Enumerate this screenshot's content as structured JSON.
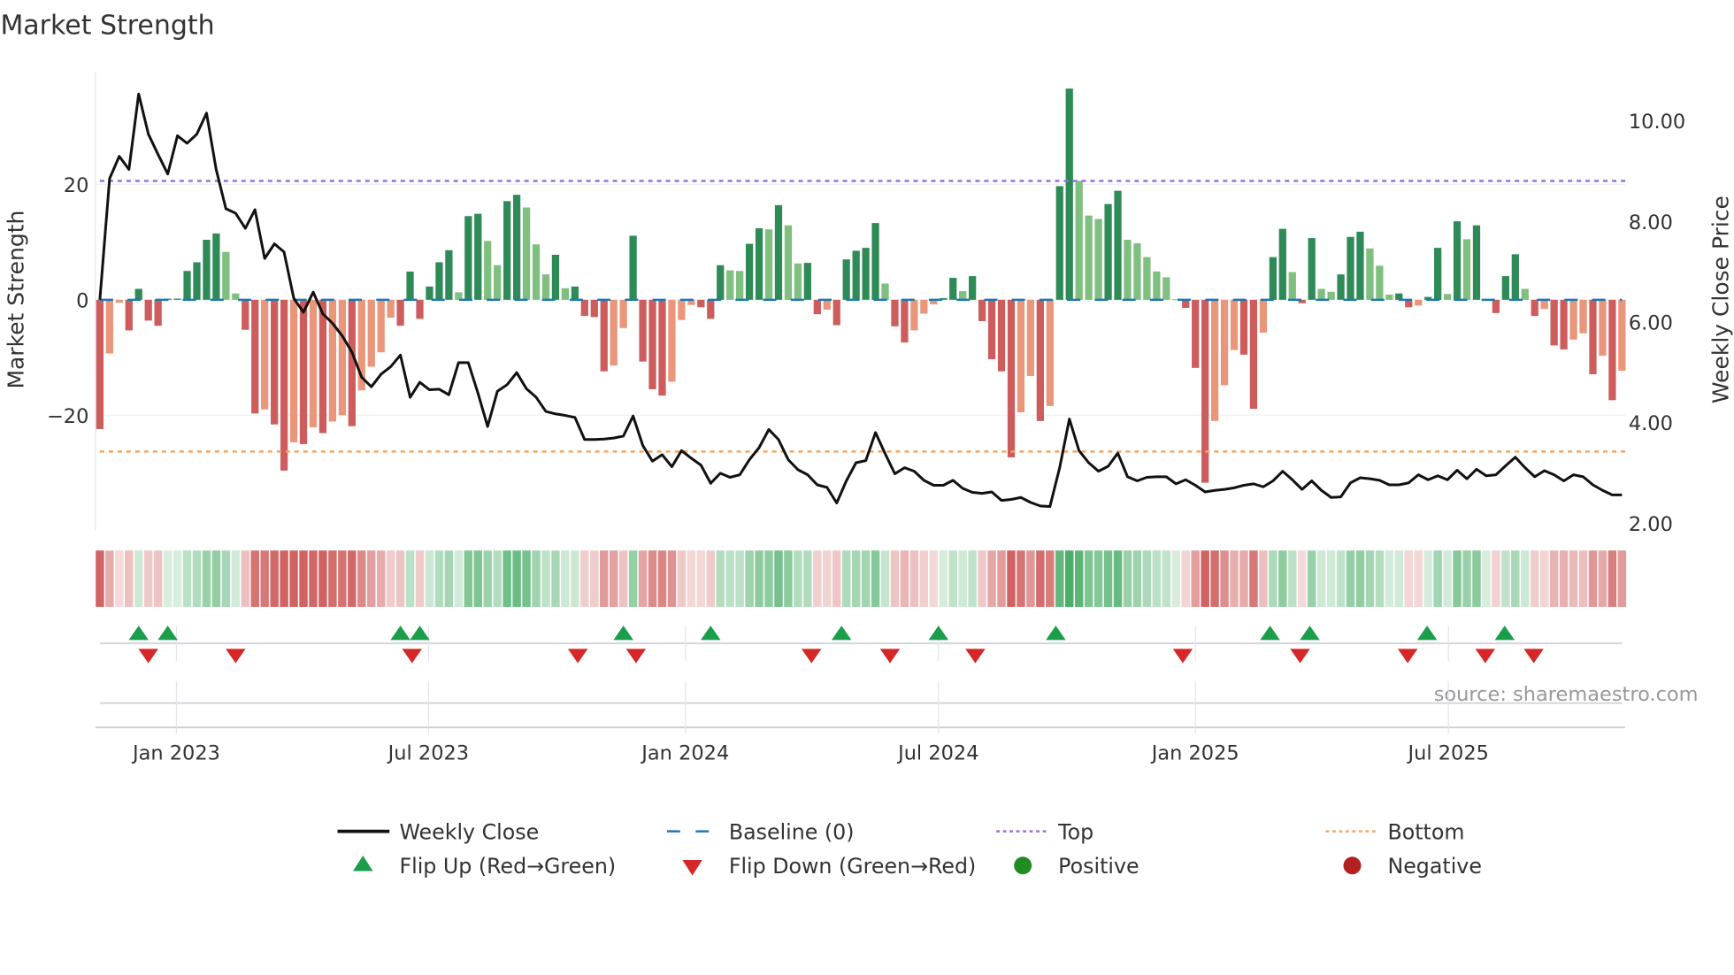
{
  "chart_data": {
    "type": "bar",
    "title": "Market Strength",
    "ylabel_left": "Market Strength",
    "ylabel_right": "Weekly Close Price",
    "source": "source: sharemaestro.com",
    "ylim_left": [
      -40,
      39.5
    ],
    "ylim_right": [
      1.85,
      10.97
    ],
    "yticks_left": [
      {
        "value": 20,
        "label": "20"
      },
      {
        "value": 0,
        "label": "0"
      },
      {
        "value": -20,
        "label": "−20"
      }
    ],
    "yticks_right": [
      {
        "value": 10,
        "label": "10.00"
      },
      {
        "value": 8,
        "label": "8.00"
      },
      {
        "value": 6,
        "label": "6.00"
      },
      {
        "value": 4,
        "label": "4.00"
      },
      {
        "value": 2,
        "label": "2.00"
      }
    ],
    "xticks": [
      {
        "index": 7.9,
        "label": "Jan 2023"
      },
      {
        "index": 33.9,
        "label": "Jul 2023"
      },
      {
        "index": 60.4,
        "label": "Jan 2024"
      },
      {
        "index": 86.5,
        "label": "Jul 2024"
      },
      {
        "index": 113,
        "label": "Jan 2025"
      },
      {
        "index": 139.1,
        "label": "Jul 2025"
      }
    ],
    "top_level": 20.6,
    "bottom_level": -26.3,
    "strength": [
      -22.4,
      -9.3,
      -0.5,
      -5.3,
      1.9,
      -3.6,
      -4.5,
      0.2,
      0.2,
      5.0,
      6.5,
      10.4,
      11.5,
      8.3,
      1.1,
      -5.2,
      -19.7,
      -19.0,
      -21.6,
      -29.6,
      -24.7,
      -25.0,
      -22.1,
      -23.1,
      -21.1,
      -20.0,
      -21.9,
      -15.7,
      -11.6,
      -9.1,
      -3.1,
      -4.5,
      4.9,
      -3.3,
      2.3,
      6.5,
      8.6,
      1.3,
      14.5,
      14.9,
      10.2,
      6.0,
      17.1,
      18.2,
      16.0,
      9.6,
      4.4,
      7.8,
      2.0,
      2.3,
      -2.8,
      -3.0,
      -12.4,
      -11.4,
      -4.9,
      11.1,
      -10.7,
      -15.5,
      -16.6,
      -14.2,
      -3.5,
      -0.9,
      -1.3,
      -3.3,
      6.0,
      5.1,
      5.0,
      9.7,
      12.4,
      12.2,
      16.4,
      12.9,
      6.3,
      6.4,
      -2.5,
      -1.7,
      -4.4,
      7.0,
      8.5,
      9.0,
      13.3,
      2.8,
      -4.6,
      -7.4,
      -5.3,
      -2.4,
      -0.8,
      0.3,
      3.8,
      1.5,
      4.1,
      -3.7,
      -10.3,
      -12.4,
      -27.3,
      -19.5,
      -13.2,
      -21.0,
      -18.4,
      19.7,
      36.6,
      20.6,
      14.6,
      14.0,
      16.6,
      18.9,
      10.4,
      9.8,
      7.4,
      4.9,
      3.9,
      0.1,
      -1.4,
      -11.8,
      -31.7,
      -21.0,
      -14.8,
      -8.7,
      -9.5,
      -18.9,
      -5.7,
      7.4,
      12.3,
      4.8,
      -0.6,
      10.7,
      1.9,
      1.4,
      4.4,
      10.9,
      11.8,
      8.9,
      5.9,
      0.9,
      1.1,
      -1.3,
      -1.0,
      0.5,
      9.0,
      1.0,
      13.6,
      10.5,
      12.9,
      0.1,
      -2.3,
      4.1,
      7.9,
      1.9,
      -2.8,
      -1.6,
      -7.9,
      -8.6,
      -6.9,
      -5.8,
      -12.9,
      -9.7,
      -17.4,
      -12.3
    ],
    "weekly_close": [
      6.44,
      8.85,
      9.29,
      9.03,
      10.53,
      9.73,
      9.33,
      8.94,
      9.7,
      9.55,
      9.73,
      10.15,
      9.03,
      8.25,
      8.16,
      7.86,
      8.23,
      7.26,
      7.55,
      7.39,
      6.47,
      6.19,
      6.59,
      6.16,
      5.97,
      5.72,
      5.4,
      4.9,
      4.71,
      4.96,
      5.11,
      5.34,
      4.5,
      4.8,
      4.65,
      4.66,
      4.55,
      5.19,
      5.19,
      4.58,
      3.92,
      4.62,
      4.75,
      4.99,
      4.67,
      4.5,
      4.22,
      4.17,
      4.14,
      4.1,
      3.66,
      3.66,
      3.67,
      3.69,
      3.73,
      4.13,
      3.54,
      3.23,
      3.36,
      3.12,
      3.44,
      3.29,
      3.15,
      2.79,
      2.99,
      2.91,
      2.96,
      3.26,
      3.5,
      3.86,
      3.66,
      3.26,
      3.06,
      2.96,
      2.76,
      2.71,
      2.4,
      2.84,
      3.2,
      3.24,
      3.8,
      3.38,
      2.98,
      3.1,
      3.03,
      2.85,
      2.75,
      2.75,
      2.85,
      2.69,
      2.61,
      2.59,
      2.62,
      2.45,
      2.47,
      2.51,
      2.41,
      2.34,
      2.33,
      3.1,
      4.07,
      3.44,
      3.2,
      3.03,
      3.13,
      3.39,
      2.92,
      2.84,
      2.91,
      2.92,
      2.92,
      2.78,
      2.86,
      2.75,
      2.62,
      2.65,
      2.67,
      2.7,
      2.75,
      2.78,
      2.72,
      2.84,
      3.03,
      2.86,
      2.67,
      2.84,
      2.65,
      2.51,
      2.52,
      2.8,
      2.9,
      2.88,
      2.85,
      2.76,
      2.76,
      2.8,
      2.96,
      2.86,
      2.94,
      2.86,
      3.05,
      2.88,
      3.07,
      2.94,
      2.96,
      3.14,
      3.31,
      3.1,
      2.92,
      3.04,
      2.96,
      2.84,
      2.96,
      2.92,
      2.76,
      2.65,
      2.56,
      2.56
    ],
    "flip_up_indices": [
      4,
      7,
      31,
      33,
      54,
      63,
      76.5,
      86.5,
      98.6,
      120.7,
      124.8,
      136.9,
      144.9
    ],
    "flip_down_indices": [
      5,
      14,
      32.2,
      49.3,
      55.3,
      73.4,
      81.5,
      90.3,
      111.7,
      123.8,
      134.9,
      142.9,
      147.9
    ],
    "legend": {
      "placement": "bottom",
      "items": [
        {
          "label": "Weekly Close",
          "kind": "line"
        },
        {
          "label": "Baseline (0)",
          "kind": "dash"
        },
        {
          "label": "Top",
          "kind": "dot-purple"
        },
        {
          "label": "Bottom",
          "kind": "dot-orange"
        },
        {
          "label": "Flip Up (Red→Green)",
          "kind": "tri-up"
        },
        {
          "label": "Flip Down (Green→Red)",
          "kind": "tri-down"
        },
        {
          "label": "Positive",
          "kind": "circle-pos"
        },
        {
          "label": "Negative",
          "kind": "circle-neg"
        }
      ]
    },
    "colors": {
      "pos_rising": "#2e8b57",
      "pos_falling": "#7fbf7f",
      "neg_falling": "#cd5c5c",
      "neg_rising": "#e9967a",
      "price": "#111111",
      "baseline": "#1f77b4",
      "top": "#9b6ee0",
      "bottom": "#f4a460",
      "flip_up": "#1a9e4a",
      "flip_down": "#d62728",
      "positive": "#228b22",
      "negative": "#b22222"
    }
  }
}
